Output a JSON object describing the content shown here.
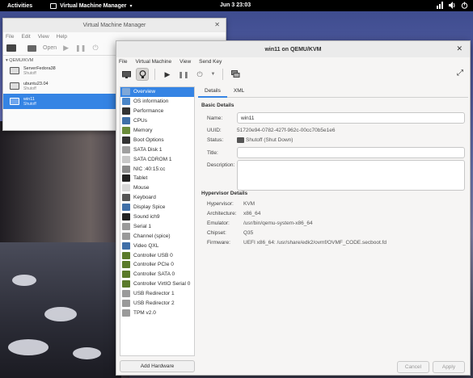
{
  "topbar": {
    "activities": "Activities",
    "app_name": "Virtual Machine Manager",
    "clock": "Jun 3  23:03"
  },
  "vmm_window": {
    "title": "Virtual Machine Manager",
    "menu": [
      "File",
      "Edit",
      "View",
      "Help"
    ],
    "open_label": "Open",
    "group": "QEMU/KVM",
    "vms": [
      {
        "name": "ServerFedora38",
        "state": "Shutoff"
      },
      {
        "name": "ubuntu23.04",
        "state": "Shutoff"
      },
      {
        "name": "win11",
        "state": "Shutoff"
      }
    ]
  },
  "main_window": {
    "title": "win11 on QEMU/KVM",
    "menu": [
      "File",
      "Virtual Machine",
      "View",
      "Send Key"
    ],
    "hardware": [
      {
        "label": "Overview",
        "icon": "overview-icon",
        "color": "#7fa8d8"
      },
      {
        "label": "OS information",
        "icon": "os-info-icon",
        "color": "#4a86c8"
      },
      {
        "label": "Performance",
        "icon": "performance-icon",
        "color": "#333333"
      },
      {
        "label": "CPUs",
        "icon": "cpu-icon",
        "color": "#3f6fa8"
      },
      {
        "label": "Memory",
        "icon": "memory-icon",
        "color": "#6a8c3a"
      },
      {
        "label": "Boot Options",
        "icon": "boot-icon",
        "color": "#333333"
      },
      {
        "label": "SATA Disk 1",
        "icon": "disk-icon",
        "color": "#a0a0a0"
      },
      {
        "label": "SATA CDROM 1",
        "icon": "cdrom-icon",
        "color": "#c8c8c8"
      },
      {
        "label": "NIC :40:15:cc",
        "icon": "nic-icon",
        "color": "#8a8a8a"
      },
      {
        "label": "Tablet",
        "icon": "tablet-icon",
        "color": "#222222"
      },
      {
        "label": "Mouse",
        "icon": "mouse-icon",
        "color": "#d8d8d8"
      },
      {
        "label": "Keyboard",
        "icon": "keyboard-icon",
        "color": "#555555"
      },
      {
        "label": "Display Spice",
        "icon": "display-icon",
        "color": "#3f6fa8"
      },
      {
        "label": "Sound ich9",
        "icon": "sound-icon",
        "color": "#222222"
      },
      {
        "label": "Serial 1",
        "icon": "serial-icon",
        "color": "#9a9a9a"
      },
      {
        "label": "Channel (spice)",
        "icon": "channel-icon",
        "color": "#9a9a9a"
      },
      {
        "label": "Video QXL",
        "icon": "video-icon",
        "color": "#3f6fa8"
      },
      {
        "label": "Controller USB 0",
        "icon": "controller-icon",
        "color": "#5a7a2a"
      },
      {
        "label": "Controller PCIe 0",
        "icon": "controller-icon",
        "color": "#5a7a2a"
      },
      {
        "label": "Controller SATA 0",
        "icon": "controller-icon",
        "color": "#5a7a2a"
      },
      {
        "label": "Controller VirtIO Serial 0",
        "icon": "controller-icon",
        "color": "#5a7a2a"
      },
      {
        "label": "USB Redirector 1",
        "icon": "usb-icon",
        "color": "#9a9a9a"
      },
      {
        "label": "USB Redirector 2",
        "icon": "usb-icon",
        "color": "#9a9a9a"
      },
      {
        "label": "TPM v2.0",
        "icon": "tpm-icon",
        "color": "#9a9a9a"
      }
    ],
    "add_hardware": "Add Hardware",
    "tabs": [
      "Details",
      "XML"
    ],
    "basic": {
      "title": "Basic Details",
      "name_label": "Name:",
      "name_value": "win11",
      "uuid_label": "UUID:",
      "uuid_value": "51720e94-0782-427f-962c-00cc70b5e1e6",
      "status_label": "Status:",
      "status_value": "Shutoff (Shut Down)",
      "title_label": "Title:",
      "title_value": "",
      "desc_label": "Description:"
    },
    "hypervisor": {
      "title": "Hypervisor Details",
      "rows": [
        {
          "label": "Hypervisor:",
          "value": "KVM"
        },
        {
          "label": "Architecture:",
          "value": "x86_64"
        },
        {
          "label": "Emulator:",
          "value": "/usr/bin/qemu-system-x86_64"
        },
        {
          "label": "Chipset:",
          "value": "Q35"
        },
        {
          "label": "Firmware:",
          "value": "UEFI x86_64: /usr/share/edk2/ovmf/OVMF_CODE.secboot.fd"
        }
      ]
    },
    "cancel": "Cancel",
    "apply": "Apply"
  }
}
